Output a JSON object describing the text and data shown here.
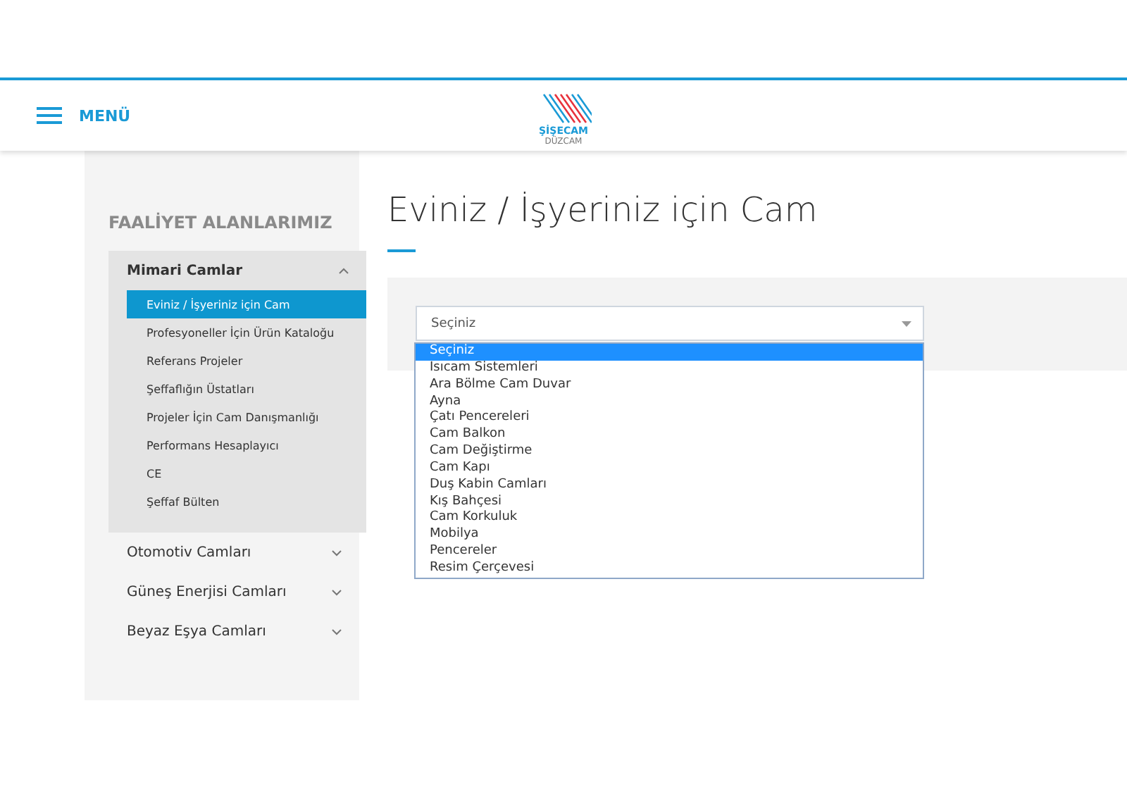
{
  "header": {
    "menu_label": "MENÜ",
    "logo": {
      "brand": "ŞİŞECAM",
      "sub": "DÜZCAM"
    }
  },
  "sidebar": {
    "heading": "FAALİYET ALANLARIMIZ",
    "groups": [
      {
        "label": "Mimari Camlar",
        "expanded": true,
        "children": [
          {
            "label": "Eviniz / İşyeriniz için Cam",
            "selected": true
          },
          {
            "label": "Profesyoneller İçin Ürün Kataloğu",
            "selected": false
          },
          {
            "label": "Referans Projeler",
            "selected": false
          },
          {
            "label": "Şeffaflığın Üstatları",
            "selected": false
          },
          {
            "label": "Projeler İçin Cam Danışmanlığı",
            "selected": false
          },
          {
            "label": "Performans Hesaplayıcı",
            "selected": false
          },
          {
            "label": "CE",
            "selected": false
          },
          {
            "label": "Şeffaf Bülten",
            "selected": false
          }
        ]
      },
      {
        "label": "Otomotiv Camları",
        "expanded": false
      },
      {
        "label": "Güneş Enerjisi Camları",
        "expanded": false
      },
      {
        "label": "Beyaz Eşya Camları",
        "expanded": false
      }
    ]
  },
  "main": {
    "title": "Eviniz / İşyeriniz için Cam",
    "select": {
      "value": "Seçiniz",
      "expanded": true,
      "options": [
        {
          "label": "Seçiniz",
          "selected": true
        },
        {
          "label": "Isıcam Sistemleri",
          "selected": false
        },
        {
          "label": "Ara Bölme Cam Duvar",
          "selected": false
        },
        {
          "label": "Ayna",
          "selected": false
        },
        {
          "label": "Çatı Pencereleri",
          "selected": false
        },
        {
          "label": "Cam Balkon",
          "selected": false
        },
        {
          "label": "Cam Değiştirme",
          "selected": false
        },
        {
          "label": "Cam Kapı",
          "selected": false
        },
        {
          "label": "Duş Kabin Camları",
          "selected": false
        },
        {
          "label": "Kış Bahçesi",
          "selected": false
        },
        {
          "label": "Cam Korkuluk",
          "selected": false
        },
        {
          "label": "Mobilya",
          "selected": false
        },
        {
          "label": "Pencereler",
          "selected": false
        },
        {
          "label": "Resim Çerçevesi",
          "selected": false
        }
      ]
    }
  }
}
